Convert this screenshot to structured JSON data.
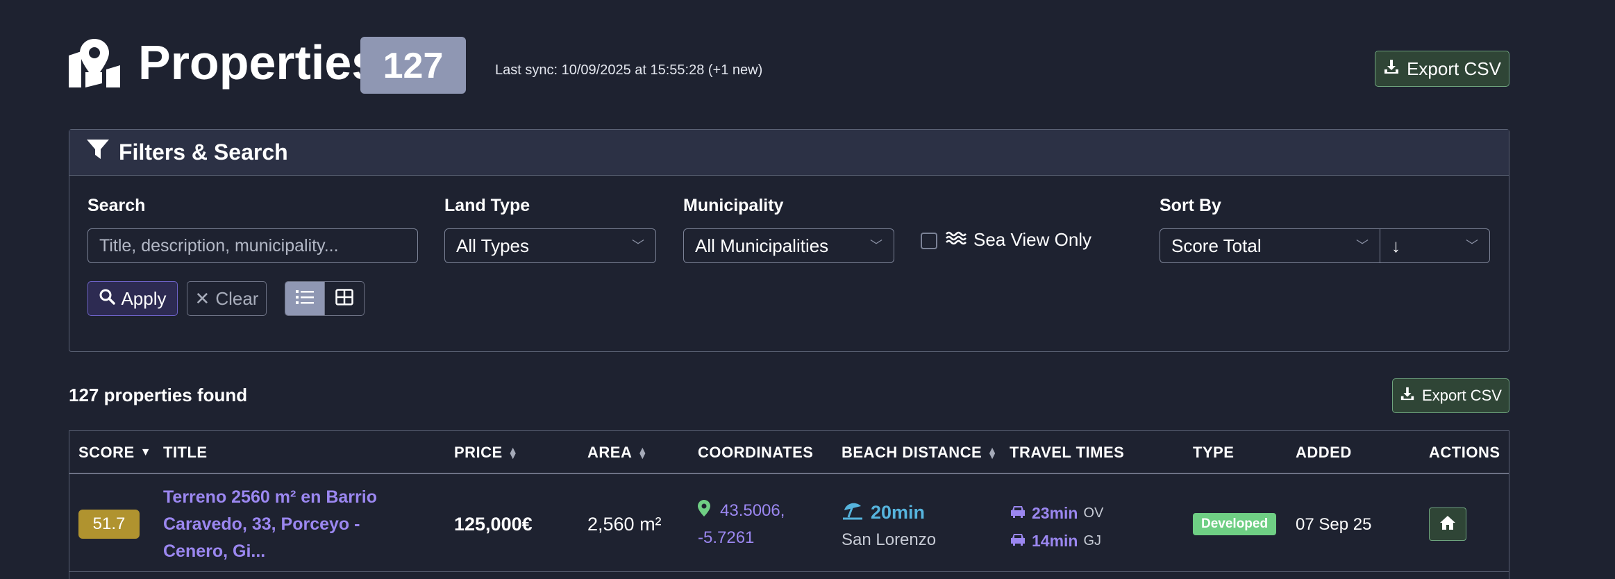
{
  "header": {
    "icon": "map-location-icon",
    "title": "Properties",
    "count": "127",
    "sync": "Last sync: 10/09/2025 at 15:55:28 (+1 new)",
    "export_label": "Export CSV"
  },
  "filters": {
    "title": "Filters & Search",
    "search_label": "Search",
    "search_placeholder": "Title, description, municipality...",
    "land_type_label": "Land Type",
    "land_type_value": "All Types",
    "municipality_label": "Municipality",
    "municipality_value": "All Municipalities",
    "sea_view_label": "Sea View Only",
    "sea_view_checked": false,
    "sort_label": "Sort By",
    "sort_value": "Score Total",
    "sort_direction": "↓",
    "apply_label": "Apply",
    "clear_label": "Clear",
    "view_modes": [
      "list",
      "grid"
    ],
    "active_view": "list"
  },
  "results": {
    "found_text": "127 properties found",
    "export_label": "Export CSV"
  },
  "table": {
    "columns": [
      "SCORE",
      "TITLE",
      "PRICE",
      "AREA",
      "COORDINATES",
      "BEACH DISTANCE",
      "TRAVEL TIMES",
      "TYPE",
      "ADDED",
      "ACTIONS"
    ],
    "rows": [
      {
        "score": "51.7",
        "title": "Terreno 2560 m² en Barrio Caravedo, 33, Porceyo - Cenero, Gi...",
        "price": "125,000€",
        "area": "2,560 m²",
        "lat": "43.5006,",
        "lng": "-5.7261",
        "beach_time": "20min",
        "beach_name": "San Lorenzo",
        "travel": [
          {
            "mins": "23min",
            "dest": "OV"
          },
          {
            "mins": "14min",
            "dest": "GJ"
          }
        ],
        "type": "Developed",
        "added": "07 Sep 25"
      }
    ]
  },
  "colors": {
    "background": "#1e2230",
    "accent_purple": "#9b87f0",
    "badge_score": "#b0932f",
    "badge_type": "#6fcf84",
    "beach_blue": "#56b4dd",
    "export_green": "#2f4536"
  }
}
